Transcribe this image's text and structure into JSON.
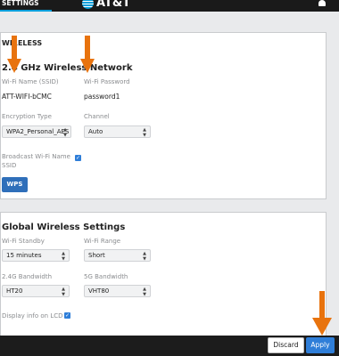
{
  "header": {
    "tab_label": "SETTINGS",
    "brand": "AT&T"
  },
  "wireless": {
    "section_label": "WIRELESS",
    "title": "2.4 GHz Wireless Network",
    "ssid_label": "Wi-Fi Name (SSID)",
    "ssid_value": "ATT-WIFI-bCMC",
    "password_label": "Wi-Fi Password",
    "password_value": "password1",
    "encryption_label": "Encryption Type",
    "encryption_value": "WPA2_Personal_AES",
    "channel_label": "Channel",
    "channel_value": "Auto",
    "broadcast_label_line1": "Broadcast Wi-Fi Name",
    "broadcast_label_line2": "SSID",
    "broadcast_checked": true,
    "wps_label": "WPS"
  },
  "global": {
    "title": "Global Wireless Settings",
    "standby_label": "Wi-Fi Standby",
    "standby_value": "15 minutes",
    "range_label": "Wi-Fi Range",
    "range_value": "Short",
    "bw24_label": "2.4G Bandwidth",
    "bw24_value": "HT20",
    "bw5_label": "5G Bandwidth",
    "bw5_value": "VHT80",
    "lcd_label": "Display info on LCD",
    "lcd_checked": true
  },
  "footer": {
    "discard_label": "Discard",
    "apply_label": "Apply"
  },
  "colors": {
    "accent": "#2f7ed8",
    "annotation_arrow": "#e8730e",
    "topbar": "#1a1a1a"
  }
}
